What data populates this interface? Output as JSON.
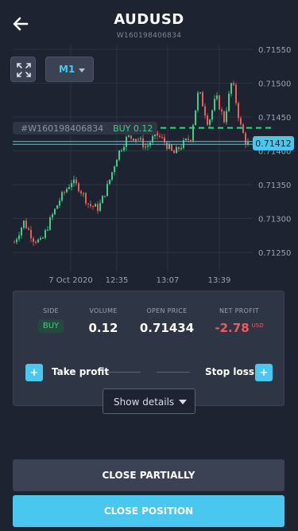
{
  "header": {
    "title": "AUDUSD",
    "subtitle": "W160198406834"
  },
  "chart": {
    "timeframe": "M1",
    "price_labels": [
      "0.71550",
      "0.71500",
      "0.71450",
      "0.71400",
      "0.71350",
      "0.71300",
      "0.71250"
    ],
    "time_labels": [
      "7 Oct 2020",
      "12:35",
      "13:07",
      "13:39"
    ],
    "order_tag": {
      "id": "#W160198406834",
      "side": "BUY 0.12"
    },
    "current_price": "0.71412",
    "colors": {
      "up": "#3ecf84",
      "down": "#ef5a5a",
      "accent": "#49c7ee"
    }
  },
  "position": {
    "side_label": "SIDE",
    "side_value": "BUY",
    "volume_label": "VOLUME",
    "volume_value": "0.12",
    "open_price_label": "OPEN PRICE",
    "open_price_value": "0.71434",
    "net_profit_label": "NET PROFIT",
    "net_profit_value": "-2.78",
    "net_profit_currency": "USD"
  },
  "sltp": {
    "take_profit_label": "Take profit",
    "stop_loss_label": "Stop loss",
    "plus_symbol": "+"
  },
  "details_button": "Show details",
  "actions": {
    "close_partially": "CLOSE PARTIALLY",
    "close_position": "CLOSE POSITION"
  }
}
